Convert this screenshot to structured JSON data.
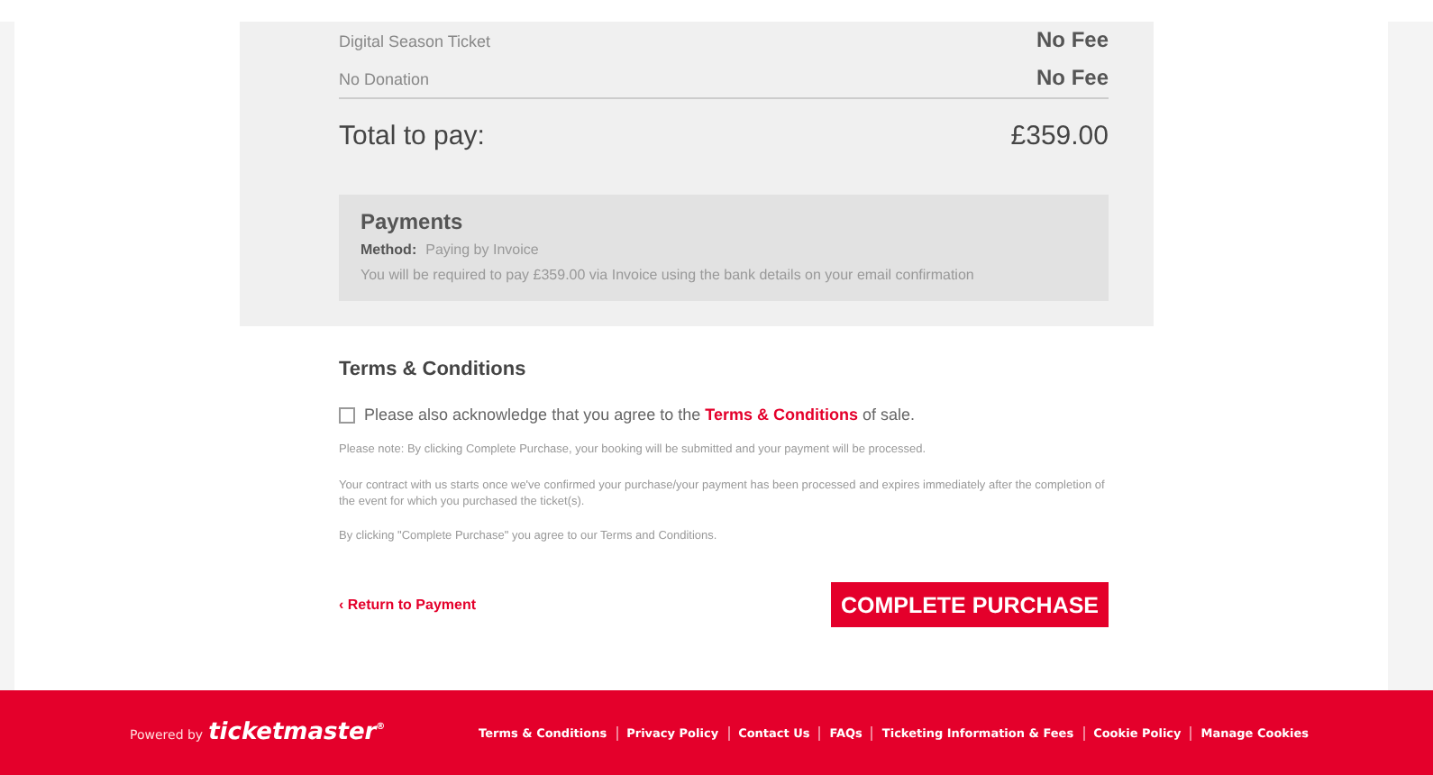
{
  "summary": {
    "lines": [
      {
        "label": "Digital Season Ticket",
        "value": "No Fee"
      },
      {
        "label": "No Donation",
        "value": "No Fee"
      }
    ],
    "total": {
      "label": "Total to pay:",
      "value": "£359.00"
    },
    "payments": {
      "title": "Payments",
      "method_label": "Method:",
      "method_value": "Paying by Invoice",
      "note": "You will be required to pay £359.00 via Invoice using the bank details on your email confirmation"
    }
  },
  "terms": {
    "title": "Terms & Conditions",
    "checkbox": {
      "checked": false,
      "before": "Please also acknowledge that you agree to the",
      "link": "Terms & Conditions",
      "after": "of sale."
    },
    "notes": [
      "Please note: By clicking Complete Purchase, your booking will be submitted and your payment will be processed.",
      "Your contract with us starts once we've confirmed your purchase/your payment has been processed and expires immediately after the completion of the event for which you purchased the ticket(s).",
      "By clicking \"Complete Purchase\" you agree to our Terms and Conditions."
    ]
  },
  "actions": {
    "back": "‹ Return to Payment",
    "submit": "COMPLETE PURCHASE"
  },
  "footer": {
    "powered_by": "Powered by",
    "brand": "ticketmaster",
    "brand_mark": "®",
    "links": [
      "Terms & Conditions",
      "Privacy Policy",
      "Contact Us",
      "FAQs",
      "Ticketing Information & Fees",
      "Cookie Policy",
      "Manage Cookies"
    ]
  }
}
